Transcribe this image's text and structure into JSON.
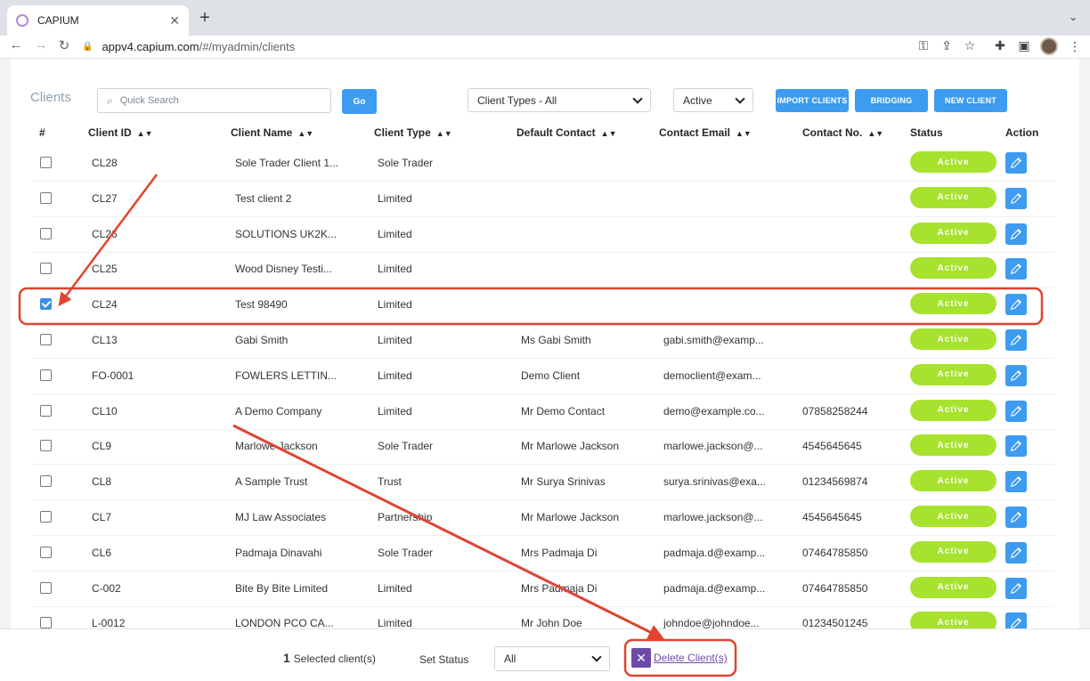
{
  "browser": {
    "tab_title": "CAPIUM",
    "url_host": "appv4.capium.com",
    "url_path": "/#/myadmin/clients"
  },
  "header": {
    "page_title": "Clients",
    "search_placeholder": "Quick Search",
    "go_label": "Go",
    "client_types_value": "Client Types - All",
    "active_value": "Active",
    "import_label": "IMPORT CLIENTS",
    "bridging_label": "BRIDGING",
    "new_client_label": "NEW CLIENT"
  },
  "table": {
    "columns": [
      "#",
      "Client ID",
      "Client Name",
      "Client Type",
      "Default Contact",
      "Contact Email",
      "Contact No.",
      "Status",
      "Action"
    ],
    "rows": [
      {
        "id": "CL28",
        "name": "Sole Trader Client 1...",
        "type": "Sole Trader",
        "contact": "",
        "email": "",
        "phone": "",
        "status": "Active",
        "checked": false
      },
      {
        "id": "CL27",
        "name": "Test client 2",
        "type": "Limited",
        "contact": "",
        "email": "",
        "phone": "",
        "status": "Active",
        "checked": false
      },
      {
        "id": "CL26",
        "name": "SOLUTIONS UK2K...",
        "type": "Limited",
        "contact": "",
        "email": "",
        "phone": "",
        "status": "Active",
        "checked": false
      },
      {
        "id": "CL25",
        "name": "Wood Disney Testi...",
        "type": "Limited",
        "contact": "",
        "email": "",
        "phone": "",
        "status": "Active",
        "checked": false
      },
      {
        "id": "CL24",
        "name": "Test 98490",
        "type": "Limited",
        "contact": "",
        "email": "",
        "phone": "",
        "status": "Active",
        "checked": true
      },
      {
        "id": "CL13",
        "name": "Gabi Smith",
        "type": "Limited",
        "contact": "Ms Gabi Smith",
        "email": "gabi.smith@examp...",
        "phone": "",
        "status": "Active",
        "checked": false
      },
      {
        "id": "FO-0001",
        "name": "FOWLERS LETTIN...",
        "type": "Limited",
        "contact": "Demo Client",
        "email": "democlient@exam...",
        "phone": "",
        "status": "Active",
        "checked": false
      },
      {
        "id": "CL10",
        "name": "A Demo Company",
        "type": "Limited",
        "contact": "Mr Demo Contact",
        "email": "demo@example.co...",
        "phone": "07858258244",
        "status": "Active",
        "checked": false
      },
      {
        "id": "CL9",
        "name": "Marlowe Jackson",
        "type": "Sole Trader",
        "contact": "Mr Marlowe Jackson",
        "email": "marlowe.jackson@...",
        "phone": "4545645645",
        "status": "Active",
        "checked": false
      },
      {
        "id": "CL8",
        "name": "A Sample Trust",
        "type": "Trust",
        "contact": "Mr Surya Srinivas",
        "email": "surya.srinivas@exa...",
        "phone": "01234569874",
        "status": "Active",
        "checked": false
      },
      {
        "id": "CL7",
        "name": "MJ Law Associates",
        "type": "Partnership",
        "contact": "Mr Marlowe Jackson",
        "email": "marlowe.jackson@...",
        "phone": "4545645645",
        "status": "Active",
        "checked": false
      },
      {
        "id": "CL6",
        "name": "Padmaja Dinavahi",
        "type": "Sole Trader",
        "contact": "Mrs Padmaja Di",
        "email": "padmaja.d@examp...",
        "phone": "07464785850",
        "status": "Active",
        "checked": false
      },
      {
        "id": "C-002",
        "name": "Bite By Bite Limited",
        "type": "Limited",
        "contact": "Mrs Padmaja Di",
        "email": "padmaja.d@examp...",
        "phone": "07464785850",
        "status": "Active",
        "checked": false
      },
      {
        "id": "L-0012",
        "name": "LONDON PCO CA...",
        "type": "Limited",
        "contact": "Mr John Doe",
        "email": "johndoe@johndoe...",
        "phone": "01234501245",
        "status": "Active",
        "checked": false
      }
    ]
  },
  "bottom_bar": {
    "selected_count": "1",
    "selected_label": "Selected client(s)",
    "set_status_label": "Set Status",
    "set_status_value": "All",
    "delete_label": "Delete Client(s)"
  },
  "colors": {
    "primary_blue": "#3d9bf0",
    "status_green": "#a6e22e",
    "delete_purple": "#6e4aa8",
    "annotation_red": "#e0442e"
  }
}
